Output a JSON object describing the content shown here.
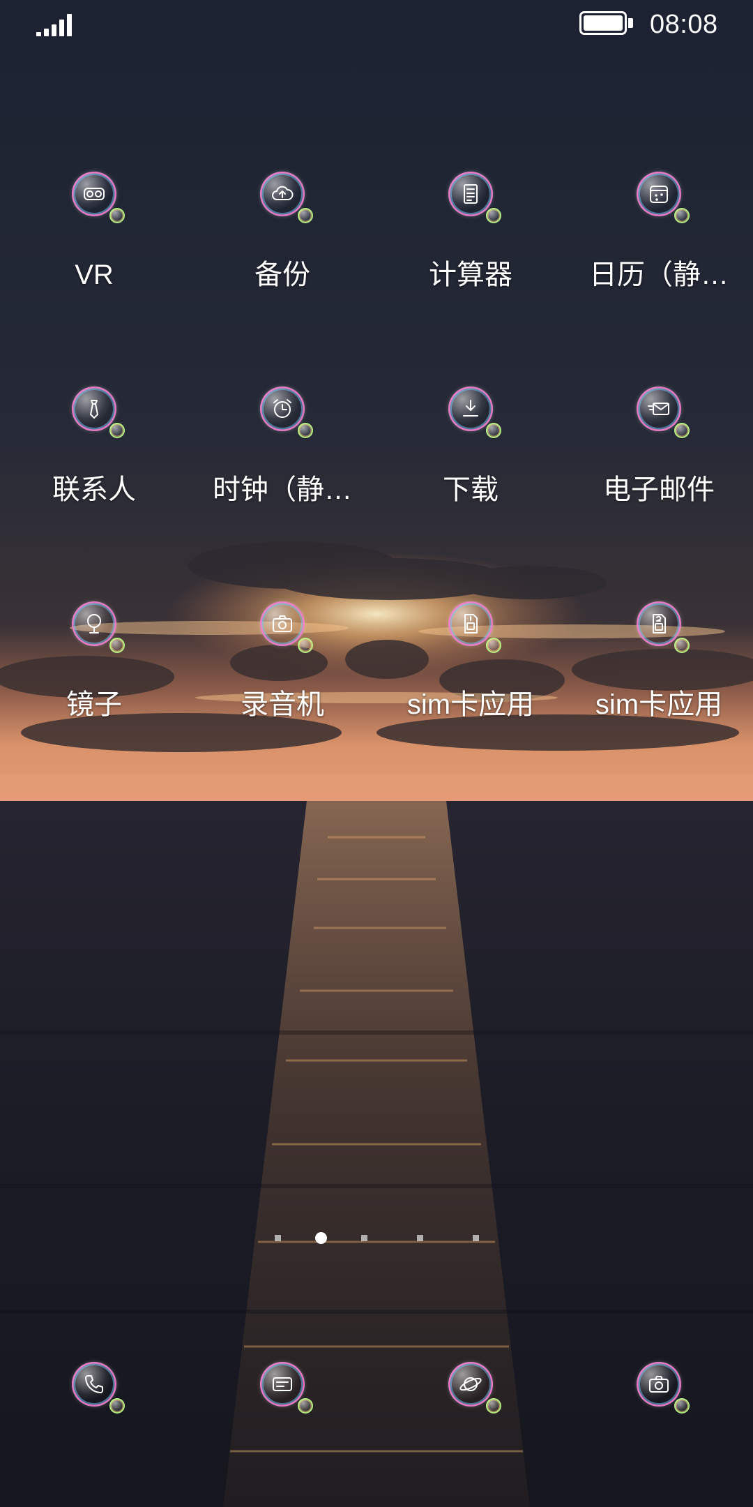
{
  "status_bar": {
    "time": "08:08",
    "signal_icon": "signal-bars-icon",
    "battery_icon": "battery-full-icon",
    "battery_level": 1.0
  },
  "home_screen": {
    "rows": [
      [
        {
          "label": "VR",
          "icon": "vr-headset-icon"
        },
        {
          "label": "备份",
          "icon": "cloud-upload-icon"
        },
        {
          "label": "计算器",
          "icon": "calculator-icon"
        },
        {
          "label": "日历（静…",
          "icon": "calendar-icon"
        }
      ],
      [
        {
          "label": "联系人",
          "icon": "contacts-tie-icon"
        },
        {
          "label": "时钟（静…",
          "icon": "alarm-clock-icon"
        },
        {
          "label": "下载",
          "icon": "download-icon"
        },
        {
          "label": "电子邮件",
          "icon": "email-icon"
        }
      ],
      [
        {
          "label": "镜子",
          "icon": "mirror-icon"
        },
        {
          "label": "录音机",
          "icon": "camera-icon"
        },
        {
          "label": "sim卡应用",
          "icon": "sim-card-1-icon"
        },
        {
          "label": "sim卡应用",
          "icon": "sim-card-2-icon"
        }
      ]
    ]
  },
  "page_indicator": {
    "pages": 5,
    "current": 2
  },
  "dock": [
    {
      "name": "phone",
      "icon": "phone-icon"
    },
    {
      "name": "messages",
      "icon": "message-icon"
    },
    {
      "name": "browser",
      "icon": "browser-planet-icon"
    },
    {
      "name": "camera",
      "icon": "camera-icon"
    }
  ],
  "colors": {
    "sky_top": "#1d2333",
    "sky_mid": "#2a2c36",
    "sunset": "#f0a870",
    "sea": "#1b1c26",
    "glow": "#e6a45a"
  }
}
